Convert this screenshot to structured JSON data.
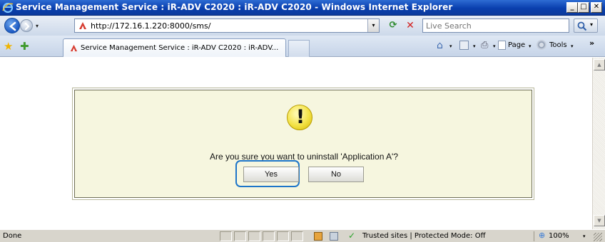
{
  "window": {
    "title": "Service Management Service : iR-ADV C2020 : iR-ADV C2020 - Windows Internet Explorer",
    "controls": {
      "minimize": "_",
      "maximize": "□",
      "close": "✕"
    }
  },
  "address_bar": {
    "url": "http://172.16.1.220:8000/sms/",
    "search_placeholder": "Live Search"
  },
  "tab": {
    "label": "Service Management Service : iR-ADV C2020 : iR-ADV..."
  },
  "toolbar": {
    "page_label": "Page",
    "tools_label": "Tools",
    "dropdown_glyph": "▾",
    "overflow_glyph": "»"
  },
  "dialog": {
    "icon_glyph": "!",
    "message": "Are you sure you want to uninstall 'Application A'?",
    "yes_label": "Yes",
    "no_label": "No",
    "highlight_color": "#1d75c9"
  },
  "status_bar": {
    "status": "Done",
    "zone": "Trusted sites | Protected Mode: Off",
    "zoom": "100%"
  },
  "colors": {
    "titlebar": "#0a3fae",
    "dialog_background": "#f6f6df",
    "warning_icon": "#f3e246"
  }
}
